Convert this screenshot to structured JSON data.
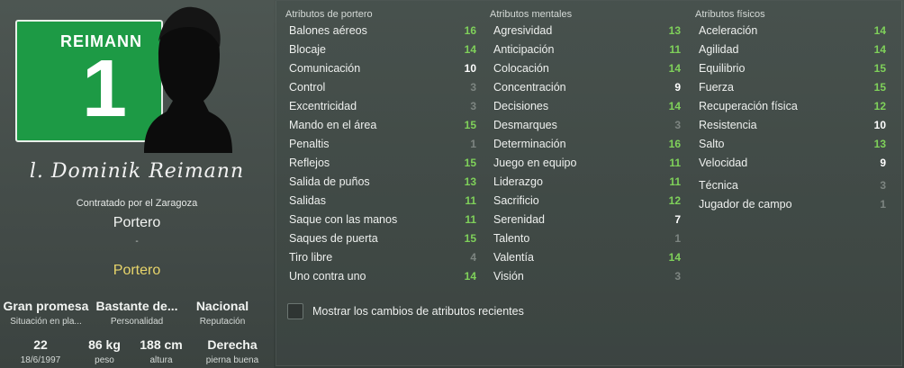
{
  "player": {
    "shirt_name": "REIMANN",
    "shirt_number": "1",
    "signature": "l. Dominik Reimann",
    "contract": "Contratado por el Zaragoza",
    "role": "Portero",
    "dash": "-",
    "position": "Portero",
    "info_top": [
      {
        "value": "Gran promesa",
        "label": "Situación en pla..."
      },
      {
        "value": "Bastante de...",
        "label": "Personalidad"
      },
      {
        "value": "Nacional",
        "label": "Reputación"
      }
    ],
    "info_bottom": [
      {
        "value": "22",
        "label": "18/6/1997"
      },
      {
        "value": "86 kg",
        "label": "peso"
      },
      {
        "value": "188 cm",
        "label": "altura"
      },
      {
        "value": "Derecha",
        "label": "pierna buena"
      }
    ]
  },
  "colors": {
    "green": "#7fd15a",
    "white": "#ffffff",
    "grey": "#7d8581",
    "yellow": "#e8d56b"
  },
  "columns": [
    {
      "title": "Atributos de portero",
      "items": [
        {
          "name": "Balones aéreos",
          "value": "16",
          "tone": "green"
        },
        {
          "name": "Blocaje",
          "value": "14",
          "tone": "green"
        },
        {
          "name": "Comunicación",
          "value": "10",
          "tone": "white"
        },
        {
          "name": "Control",
          "value": "3",
          "tone": "grey"
        },
        {
          "name": "Excentricidad",
          "value": "3",
          "tone": "grey"
        },
        {
          "name": "Mando en el área",
          "value": "15",
          "tone": "green"
        },
        {
          "name": "Penaltis",
          "value": "1",
          "tone": "grey"
        },
        {
          "name": "Reflejos",
          "value": "15",
          "tone": "green"
        },
        {
          "name": "Salida de puños",
          "value": "13",
          "tone": "green"
        },
        {
          "name": "Salidas",
          "value": "11",
          "tone": "green"
        },
        {
          "name": "Saque con las manos",
          "value": "11",
          "tone": "green"
        },
        {
          "name": "Saques de puerta",
          "value": "15",
          "tone": "green"
        },
        {
          "name": "Tiro libre",
          "value": "4",
          "tone": "grey"
        },
        {
          "name": "Uno contra uno",
          "value": "14",
          "tone": "green"
        }
      ]
    },
    {
      "title": "Atributos mentales",
      "items": [
        {
          "name": "Agresividad",
          "value": "13",
          "tone": "green"
        },
        {
          "name": "Anticipación",
          "value": "11",
          "tone": "green"
        },
        {
          "name": "Colocación",
          "value": "14",
          "tone": "green"
        },
        {
          "name": "Concentración",
          "value": "9",
          "tone": "white"
        },
        {
          "name": "Decisiones",
          "value": "14",
          "tone": "green"
        },
        {
          "name": "Desmarques",
          "value": "3",
          "tone": "grey"
        },
        {
          "name": "Determinación",
          "value": "16",
          "tone": "green"
        },
        {
          "name": "Juego en equipo",
          "value": "11",
          "tone": "green"
        },
        {
          "name": "Liderazgo",
          "value": "11",
          "tone": "green"
        },
        {
          "name": "Sacrificio",
          "value": "12",
          "tone": "green"
        },
        {
          "name": "Serenidad",
          "value": "7",
          "tone": "white"
        },
        {
          "name": "Talento",
          "value": "1",
          "tone": "grey"
        },
        {
          "name": "Valentía",
          "value": "14",
          "tone": "green"
        },
        {
          "name": "Visión",
          "value": "3",
          "tone": "grey"
        }
      ]
    },
    {
      "title": "Atributos físicos",
      "items": [
        {
          "name": "Aceleración",
          "value": "14",
          "tone": "green"
        },
        {
          "name": "Agilidad",
          "value": "14",
          "tone": "green"
        },
        {
          "name": "Equilibrio",
          "value": "15",
          "tone": "green"
        },
        {
          "name": "Fuerza",
          "value": "15",
          "tone": "green"
        },
        {
          "name": "Recuperación física",
          "value": "12",
          "tone": "green"
        },
        {
          "name": "Resistencia",
          "value": "10",
          "tone": "white"
        },
        {
          "name": "Salto",
          "value": "13",
          "tone": "green"
        },
        {
          "name": "Velocidad",
          "value": "9",
          "tone": "white"
        }
      ],
      "extra": [
        {
          "name": "Técnica",
          "value": "3",
          "tone": "grey"
        },
        {
          "name": "Jugador de campo",
          "value": "1",
          "tone": "grey"
        }
      ]
    }
  ],
  "toggle": {
    "label": "Mostrar los cambios de atributos recientes"
  }
}
